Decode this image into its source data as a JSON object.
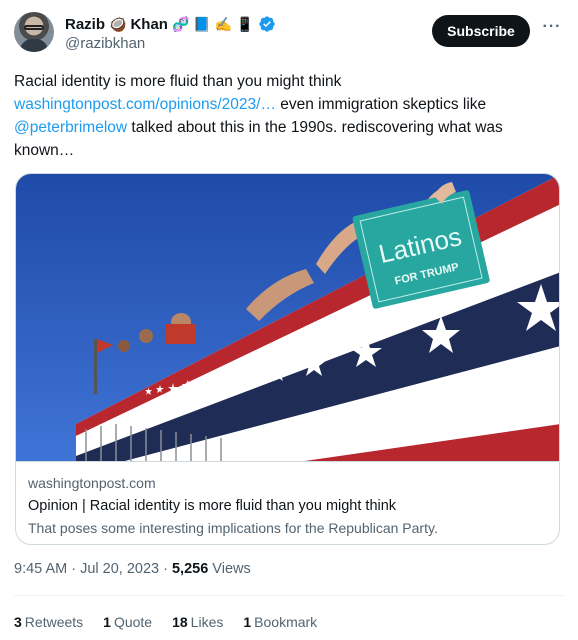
{
  "author": {
    "name": "Razib",
    "name_emoji_1": "🥥",
    "name_suffix": "Khan",
    "name_emoji_2": "🧬",
    "name_emoji_3": "📘",
    "name_emoji_4": "✍️",
    "name_emoji_5": "📱",
    "handle": "@razibkhan"
  },
  "subscribe_label": "Subscribe",
  "more_label": "···",
  "tweet": {
    "text_1": "Racial identity is more fluid than you might think",
    "link_1": "washingtonpost.com/opinions/2023/…",
    "text_2": " even immigration skeptics like ",
    "mention": "@peterbrimelow",
    "text_3": " talked about this in the 1990s. rediscovering what was known…"
  },
  "card": {
    "sign_line1": "Latinos",
    "sign_line2": "FOR TRUMP",
    "domain": "washingtonpost.com",
    "title": "Opinion | Racial identity is more fluid than you might think",
    "description": "That poses some interesting implications for the Republican Party."
  },
  "meta": {
    "time": "9:45 AM · Jul 20, 2023 · ",
    "views_count": "5,256",
    "views_label": " Views"
  },
  "stats": [
    {
      "count": "3",
      "label": "Retweets"
    },
    {
      "count": "1",
      "label": "Quote"
    },
    {
      "count": "18",
      "label": "Likes"
    },
    {
      "count": "1",
      "label": "Bookmark"
    }
  ],
  "colors": {
    "link": "#1d9bf0",
    "secondary": "#536471",
    "verified": "#1d9bf0",
    "subscribe_bg": "#0f1419"
  }
}
